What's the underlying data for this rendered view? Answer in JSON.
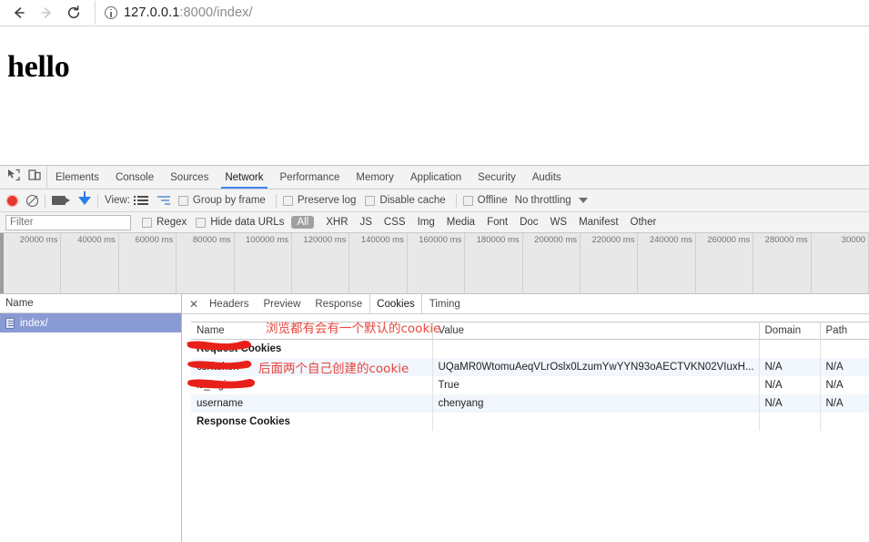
{
  "browser": {
    "back_icon": "arrow-left",
    "forward_icon": "arrow-right",
    "reload_icon": "reload",
    "info_icon": "info-circle",
    "url_host": "127.0.0.1",
    "url_rest": ":8000/index/"
  },
  "page": {
    "heading": "hello"
  },
  "devtools": {
    "inspect_icon": "inspect-element-icon",
    "device_icon": "device-toolbar-icon",
    "tabs": [
      {
        "label": "Elements",
        "active": false
      },
      {
        "label": "Console",
        "active": false
      },
      {
        "label": "Sources",
        "active": false
      },
      {
        "label": "Network",
        "active": true
      },
      {
        "label": "Performance",
        "active": false
      },
      {
        "label": "Memory",
        "active": false
      },
      {
        "label": "Application",
        "active": false
      },
      {
        "label": "Security",
        "active": false
      },
      {
        "label": "Audits",
        "active": false
      }
    ],
    "controls": {
      "record_label": "record",
      "clear_label": "clear",
      "camera_label": "capture-screenshots",
      "filter_label": "filter",
      "view_label": "View:",
      "group_by_frame": "Group by frame",
      "preserve_log": "Preserve log",
      "disable_cache": "Disable cache",
      "offline": "Offline",
      "throttling": "No throttling"
    },
    "filterbar": {
      "filter_placeholder": "Filter",
      "regex_label": "Regex",
      "hide_data_urls_label": "Hide data URLs",
      "types": [
        {
          "label": "All",
          "active": true
        },
        {
          "label": "XHR",
          "active": false
        },
        {
          "label": "JS",
          "active": false
        },
        {
          "label": "CSS",
          "active": false
        },
        {
          "label": "Img",
          "active": false
        },
        {
          "label": "Media",
          "active": false
        },
        {
          "label": "Font",
          "active": false
        },
        {
          "label": "Doc",
          "active": false
        },
        {
          "label": "WS",
          "active": false
        },
        {
          "label": "Manifest",
          "active": false
        },
        {
          "label": "Other",
          "active": false
        }
      ]
    },
    "timeline_ticks": [
      "20000 ms",
      "40000 ms",
      "60000 ms",
      "80000 ms",
      "100000 ms",
      "120000 ms",
      "140000 ms",
      "160000 ms",
      "180000 ms",
      "200000 ms",
      "220000 ms",
      "240000 ms",
      "260000 ms",
      "280000 ms",
      "30000"
    ],
    "requests": {
      "header": "Name",
      "rows": [
        {
          "name": "index/",
          "selected": true,
          "icon": "document-icon"
        }
      ]
    },
    "detail_tabs": [
      {
        "label": "Headers",
        "active": false
      },
      {
        "label": "Preview",
        "active": false
      },
      {
        "label": "Response",
        "active": false
      },
      {
        "label": "Cookies",
        "active": true
      },
      {
        "label": "Timing",
        "active": false
      }
    ],
    "close_icon": "close-icon",
    "cookies": {
      "columns": [
        "Name",
        "Value",
        "Domain",
        "Path"
      ],
      "request_section": "Request Cookies",
      "response_section": "Response Cookies",
      "rows": [
        {
          "name": "csrftoken",
          "value": "UQaMR0WtomuAeqVLrOslx0LzumYwYYN93oAECTVKN02VIuxH...",
          "domain": "N/A",
          "path": "N/A"
        },
        {
          "name": "is_login",
          "value": "True",
          "domain": "N/A",
          "path": "N/A"
        },
        {
          "name": "username",
          "value": "chenyang",
          "domain": "N/A",
          "path": "N/A"
        }
      ]
    }
  },
  "annotations": {
    "note_default_cookie": "浏览都有会有一个默认的cookie",
    "note_created_cookies": "后面两个自己创建的cookie",
    "color": "#e8453c"
  }
}
